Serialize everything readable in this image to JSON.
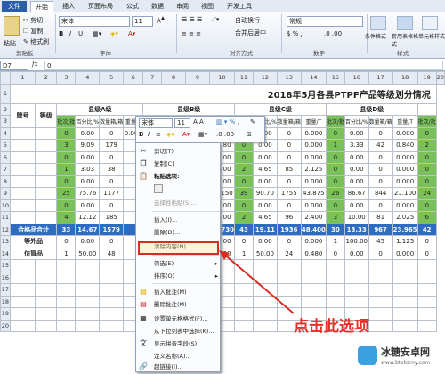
{
  "tabs": [
    "文件",
    "开始",
    "插入",
    "页面布局",
    "公式",
    "数据",
    "审阅",
    "视图",
    "开发工具"
  ],
  "ribbon": {
    "clipboard": {
      "paste": "粘贴",
      "cut": "剪切",
      "copy": "复制",
      "painter": "格式刷",
      "group": "剪贴板"
    },
    "font": {
      "name": "宋体",
      "size": "11",
      "group": "字体"
    },
    "alignment": {
      "wrap": "自动换行",
      "merge": "合并后居中",
      "group": "对齐方式"
    },
    "number": {
      "format": "常规",
      "group": "数字"
    },
    "styles": {
      "cond": "条件格式",
      "table": "套用表格格式",
      "cell": "单元格样式",
      "group": "样式"
    }
  },
  "formula_bar": {
    "name_box": "D7",
    "fx": "fx",
    "value": "0"
  },
  "columns": [
    "1",
    "2",
    "3",
    "4",
    "5",
    "6",
    "7",
    "8",
    "9",
    "10",
    "11",
    "12",
    "13",
    "14",
    "15",
    "16",
    "17",
    "18",
    "19",
    "20"
  ],
  "sheet": {
    "title": "2018年5月各县PTPF产品等级划分情况",
    "col_brand": "牌号",
    "col_grade": "等级",
    "groups": [
      "县级A级",
      "县级B级",
      "县级C级",
      "县级D级"
    ],
    "sub": [
      "批次/批",
      "百分比/%",
      "数量箱/箱",
      "重量/T"
    ],
    "rows": [
      [
        "",
        "",
        "0",
        "0.00",
        "0",
        "0.000",
        "",
        "",
        "",
        "0.000",
        "0",
        "0.00",
        "0",
        "0.000",
        "0",
        "0.00",
        "0",
        "0.000",
        "0"
      ],
      [
        "",
        "",
        "3",
        "9.09",
        "179",
        "",
        "",
        "",
        "",
        "2.080",
        "0",
        "0.00",
        "0",
        "0.000",
        "1",
        "3.33",
        "42",
        "0.840",
        "2"
      ],
      [
        "",
        "",
        "0",
        "0.00",
        "0",
        "",
        "",
        "",
        "",
        "0.000",
        "0",
        "0.00",
        "0",
        "0.000",
        "0",
        "0.00",
        "0",
        "0.000",
        "0"
      ],
      [
        "",
        "",
        "1",
        "3.03",
        "38",
        "",
        "",
        "",
        "",
        "8.300",
        "2",
        "4.65",
        "85",
        "2.125",
        "0",
        "0.00",
        "0",
        "0.000",
        "0"
      ],
      [
        "",
        "",
        "0",
        "0.00",
        "0",
        "",
        "",
        "",
        "",
        "0.000",
        "0",
        "0.00",
        "0",
        "0.000",
        "0",
        "0.00",
        "0",
        "0.000",
        "0"
      ],
      [
        "",
        "",
        "25",
        "75.76",
        "1177",
        "",
        "",
        "",
        "",
        "27.150",
        "39",
        "90.70",
        "1755",
        "43.875",
        "26",
        "86.67",
        "844",
        "21.100",
        "24"
      ],
      [
        "",
        "",
        "0",
        "0.00",
        "0",
        "",
        "",
        "",
        "",
        "0.000",
        "0",
        "0.00",
        "0",
        "0.000",
        "0",
        "0.00",
        "0",
        "0.000",
        "0"
      ],
      [
        "",
        "",
        "4",
        "12.12",
        "185",
        "",
        "",
        "",
        "",
        "1.200",
        "2",
        "4.65",
        "96",
        "2.400",
        "3",
        "10.00",
        "81",
        "2.025",
        "6"
      ]
    ],
    "total_label": "合格品合计",
    "total": [
      "33",
      "14.67",
      "1579",
      "",
      "",
      "",
      "",
      "36.730",
      "43",
      "19.11",
      "1936",
      "48.400",
      "30",
      "13.33",
      "967",
      "23.965",
      "42"
    ],
    "ext_label": "等外品",
    "ext": [
      "0",
      "0.00",
      "0",
      "",
      "",
      "",
      "",
      "0.000",
      "0",
      "0.00",
      "0",
      "0.000",
      "1",
      "100.00",
      "45",
      "1.125",
      "0"
    ],
    "fake_label": "仿冒品",
    "fake": [
      "1",
      "50.00",
      "48",
      "",
      "",
      "",
      "",
      "0.000",
      "1",
      "50.00",
      "24",
      "0.480",
      "0",
      "0.00",
      "0",
      "0.000",
      "0"
    ],
    "row_numbers": [
      "1",
      "2",
      "3",
      "4",
      "5",
      "6",
      "7",
      "8",
      "9",
      "10",
      "11",
      "12",
      "13",
      "14",
      "15",
      "16",
      "17",
      "18",
      "19",
      "20"
    ]
  },
  "mini_toolbar": {
    "font": "宋体",
    "size": "11"
  },
  "context_menu": [
    "剪切(T)",
    "复制(C)",
    "粘贴选项:",
    "",
    "选择性粘贴(S)...",
    "插入(I)...",
    "删除(D)...",
    "清除内容(N)",
    "筛选(E)",
    "排序(O)",
    "插入批注(M)",
    "删除批注(M)",
    "设置单元格格式(F)...",
    "从下拉列表中选择(K)...",
    "显示拼音字段(S)",
    "定义名称(A)...",
    "超链接(I)..."
  ],
  "callout": "点击此选项",
  "watermark": {
    "brand": "冰糖安卓网",
    "url": "www.btxtdmy.com"
  }
}
